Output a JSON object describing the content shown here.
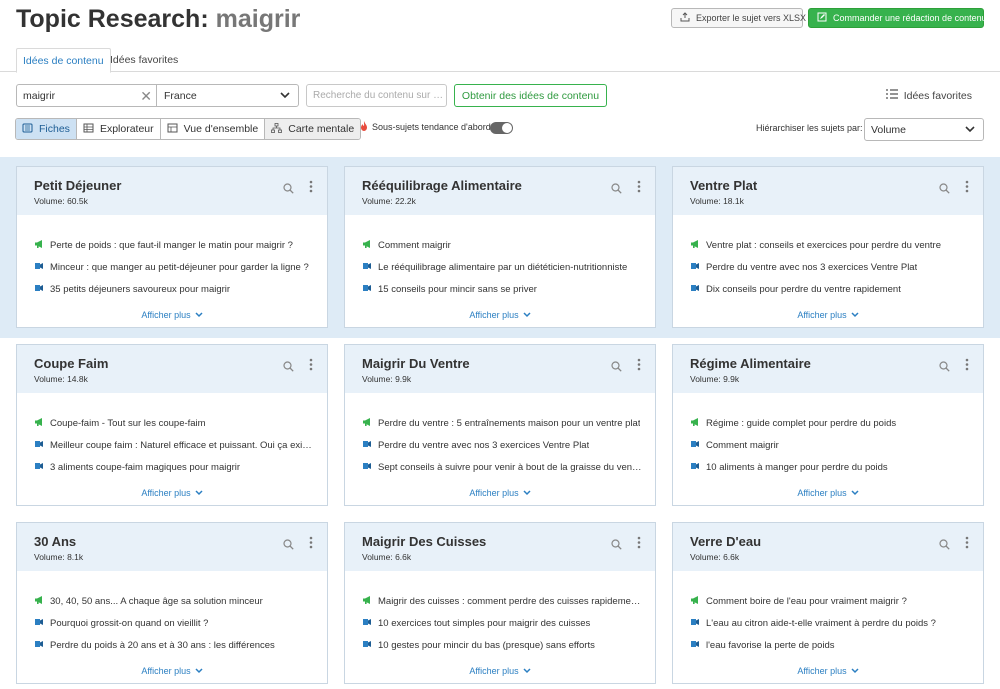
{
  "header": {
    "title_prefix": "Topic Research: ",
    "title_keyword": "maigrir",
    "export_label": "Exporter le sujet vers XLSX",
    "order_label": "Commander une rédaction de contenu"
  },
  "tabs": [
    {
      "label": "Idées de contenu",
      "active": true
    },
    {
      "label": "Idées favorites",
      "active": false
    }
  ],
  "search": {
    "keyword_value": "maigrir",
    "country_value": "France",
    "content_search_placeholder": "Recherche du contenu sur …",
    "get_ideas_label": "Obtenir des idées de contenu",
    "favorites_label": "Idées favorites"
  },
  "views": [
    {
      "label": "Fiches",
      "active": true
    },
    {
      "label": "Explorateur",
      "active": false
    },
    {
      "label": "Vue d'ensemble",
      "active": false
    },
    {
      "label": "Carte mentale",
      "active": false
    }
  ],
  "trend_label": "Sous-sujets tendance d'abord",
  "sort": {
    "label": "Hiérarchiser les sujets par:",
    "value": "Volume"
  },
  "show_more_label": "Afficher plus",
  "colors": {
    "accent_blue": "#2b7fc2",
    "green": "#37b24d",
    "band": "#deebf6",
    "card_header": "#e8f1f9"
  },
  "cards": [
    {
      "title": "Petit Déjeuner",
      "volume": "Volume: 60.5k",
      "items": [
        {
          "icon": "megaphone-icon",
          "text": "Perte de poids : que faut-il manger le matin pour maigrir ?"
        },
        {
          "icon": "question-icon",
          "text": "Minceur : que manger au petit-déjeuner pour garder la ligne ?"
        },
        {
          "icon": "question-icon",
          "text": "35 petits déjeuners savoureux pour maigrir"
        }
      ]
    },
    {
      "title": "Rééquilibrage Alimentaire",
      "volume": "Volume: 22.2k",
      "items": [
        {
          "icon": "megaphone-icon",
          "text": "Comment maigrir"
        },
        {
          "icon": "question-icon",
          "text": "Le rééquilibrage alimentaire par un diététicien-nutritionniste"
        },
        {
          "icon": "question-icon",
          "text": "15 conseils pour mincir sans se priver"
        }
      ]
    },
    {
      "title": "Ventre Plat",
      "volume": "Volume: 18.1k",
      "items": [
        {
          "icon": "megaphone-icon",
          "text": "Ventre plat : conseils et exercices pour perdre du ventre"
        },
        {
          "icon": "question-icon",
          "text": "Perdre du ventre avec nos 3 exercices Ventre Plat"
        },
        {
          "icon": "question-icon",
          "text": "Dix conseils pour perdre du ventre rapidement"
        }
      ]
    },
    {
      "title": "Coupe Faim",
      "volume": "Volume: 14.8k",
      "items": [
        {
          "icon": "megaphone-icon",
          "text": "Coupe-faim - Tout sur les coupe-faim"
        },
        {
          "icon": "question-icon",
          "text": "Meilleur coupe faim : Naturel efficace et puissant. Oui ça exis…"
        },
        {
          "icon": "question-icon",
          "text": "3 aliments coupe-faim magiques pour maigrir"
        }
      ]
    },
    {
      "title": "Maigrir Du Ventre",
      "volume": "Volume: 9.9k",
      "items": [
        {
          "icon": "megaphone-icon",
          "text": "Perdre du ventre : 5 entraînements maison pour un ventre plat"
        },
        {
          "icon": "question-icon",
          "text": "Perdre du ventre avec nos 3 exercices Ventre Plat"
        },
        {
          "icon": "question-icon",
          "text": "Sept conseils à suivre pour venir à bout de la graisse du ventre"
        }
      ]
    },
    {
      "title": "Régime Alimentaire",
      "volume": "Volume: 9.9k",
      "items": [
        {
          "icon": "megaphone-icon",
          "text": "Régime : guide complet pour perdre du poids"
        },
        {
          "icon": "question-icon",
          "text": "Comment maigrir"
        },
        {
          "icon": "question-icon",
          "text": "10 aliments à manger pour perdre du poids"
        }
      ]
    },
    {
      "title": "30 Ans",
      "volume": "Volume: 8.1k",
      "items": [
        {
          "icon": "megaphone-icon",
          "text": "30, 40, 50 ans... A chaque âge sa solution minceur"
        },
        {
          "icon": "question-icon",
          "text": "Pourquoi grossit-on quand on vieillit ?"
        },
        {
          "icon": "question-icon",
          "text": "Perdre du poids à 20 ans et à 30 ans : les différences"
        }
      ]
    },
    {
      "title": "Maigrir Des Cuisses",
      "volume": "Volume: 6.6k",
      "items": [
        {
          "icon": "megaphone-icon",
          "text": "Maigrir des cuisses : comment perdre des cuisses rapidement ?"
        },
        {
          "icon": "question-icon",
          "text": "10 exercices tout simples pour maigrir des cuisses"
        },
        {
          "icon": "question-icon",
          "text": "10 gestes pour mincir du bas (presque) sans efforts"
        }
      ]
    },
    {
      "title": "Verre D'eau",
      "volume": "Volume: 6.6k",
      "items": [
        {
          "icon": "megaphone-icon",
          "text": "Comment boire de l'eau pour vraiment maigrir ?"
        },
        {
          "icon": "question-icon",
          "text": "L'eau au citron aide-t-elle vraiment à perdre du poids ?"
        },
        {
          "icon": "question-icon",
          "text": "l'eau favorise la perte de poids"
        }
      ]
    }
  ]
}
